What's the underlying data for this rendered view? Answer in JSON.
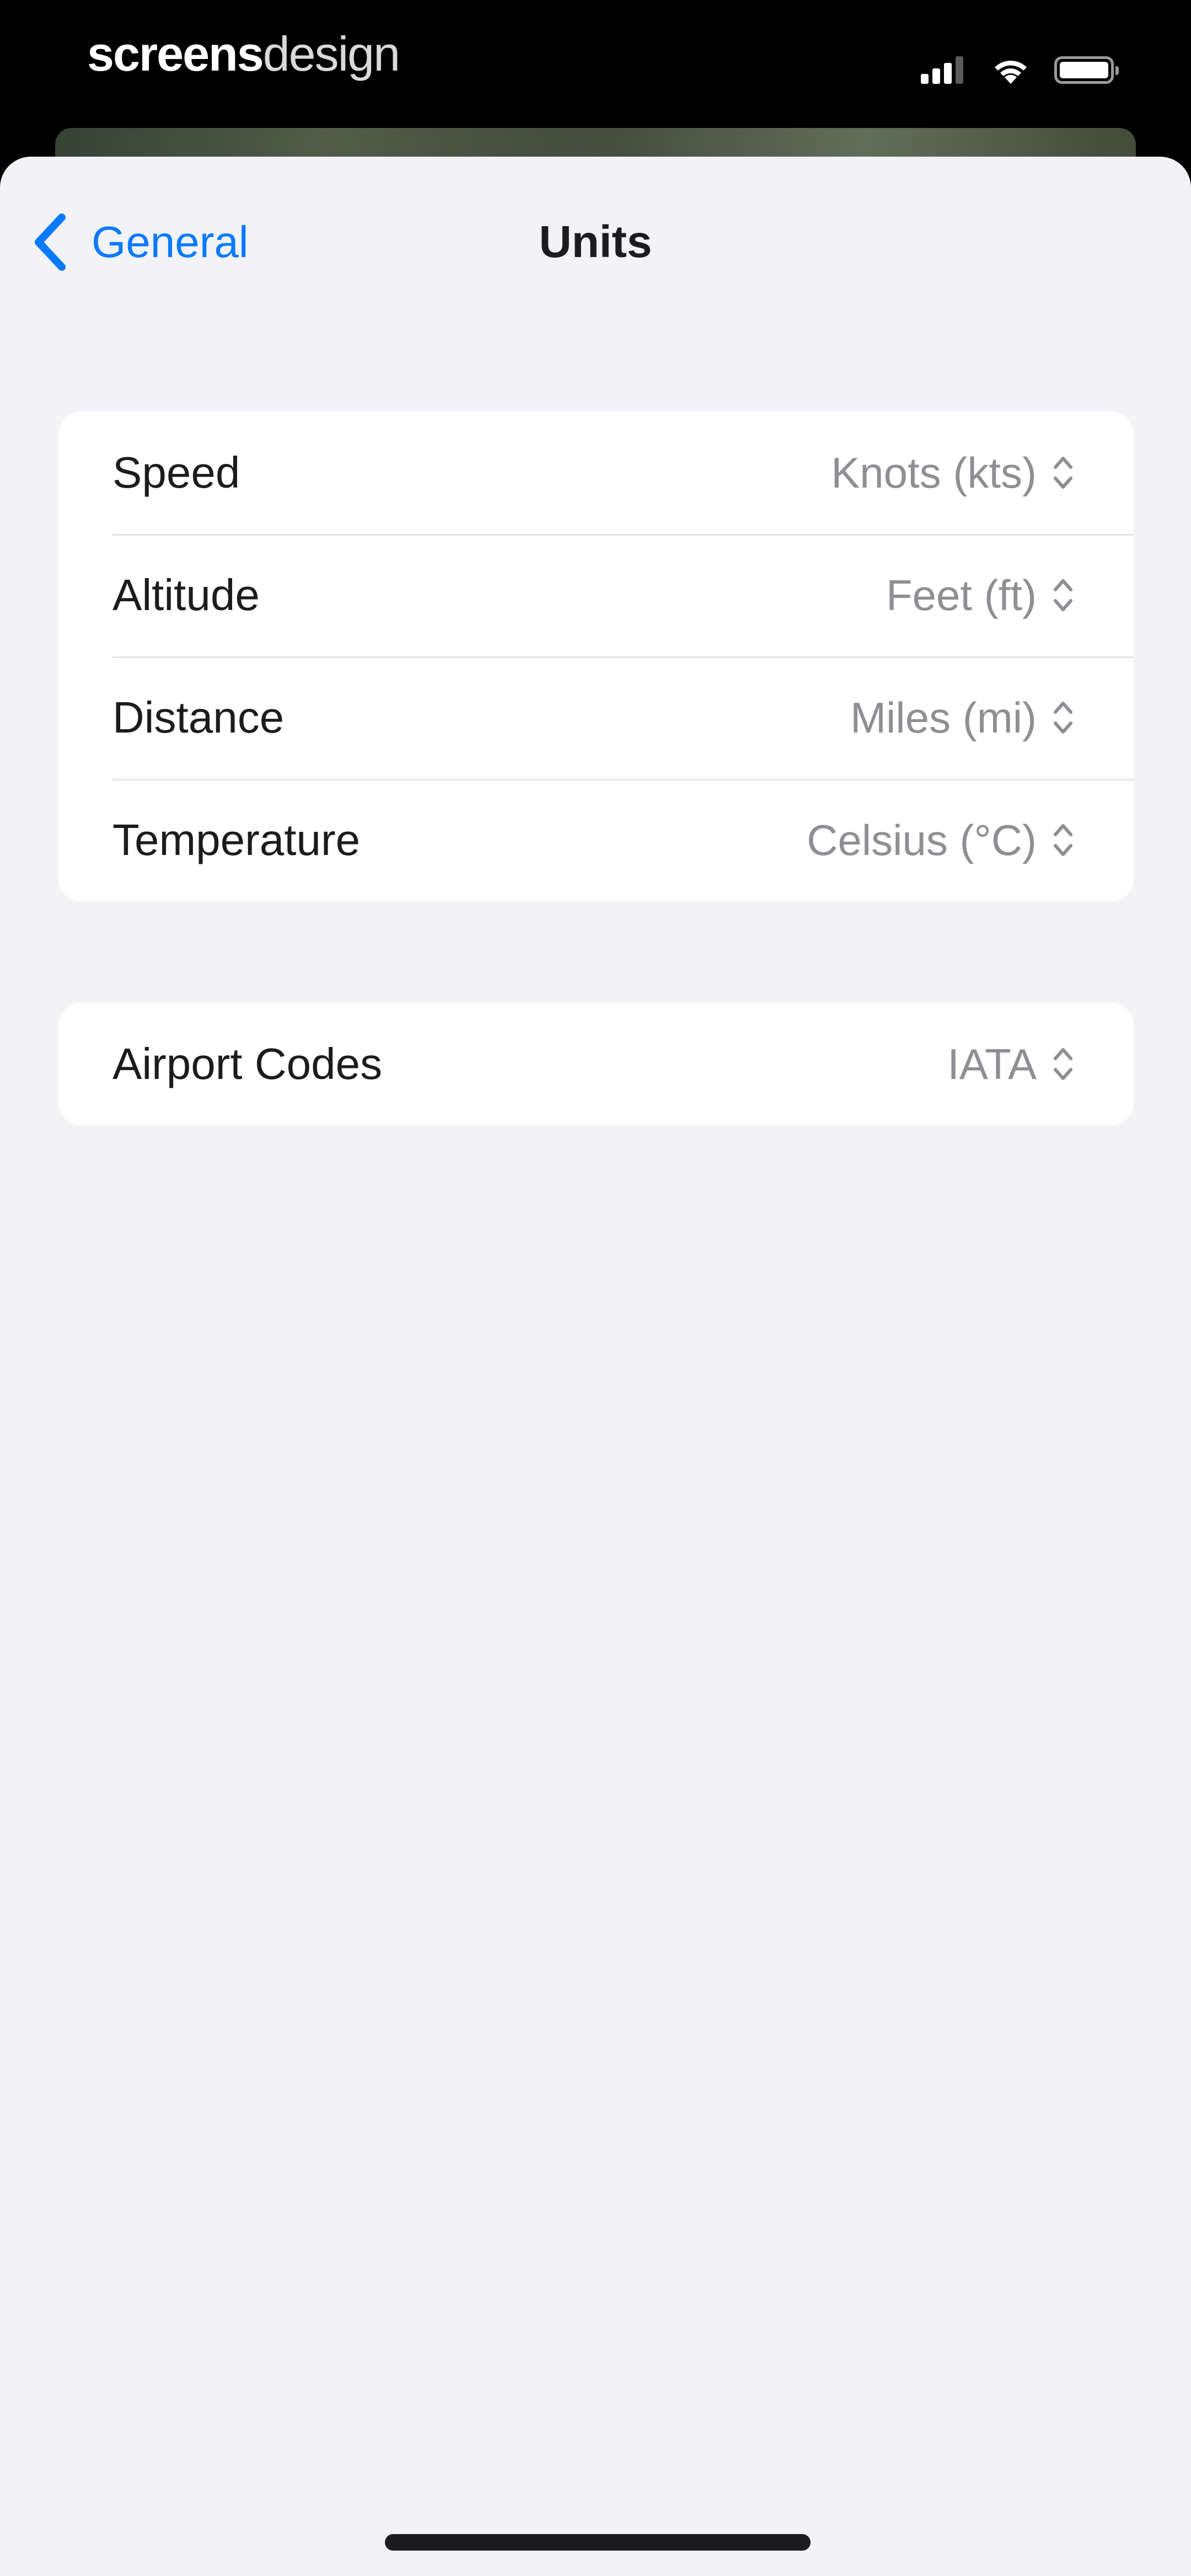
{
  "status_bar": {
    "brand_bold": "screens",
    "brand_light": "design"
  },
  "nav": {
    "back_label": "General",
    "title": "Units"
  },
  "units_group": {
    "rows": [
      {
        "label": "Speed",
        "value": "Knots (kts)"
      },
      {
        "label": "Altitude",
        "value": "Feet (ft)"
      },
      {
        "label": "Distance",
        "value": "Miles (mi)"
      },
      {
        "label": "Temperature",
        "value": "Celsius (°C)"
      }
    ]
  },
  "codes_group": {
    "rows": [
      {
        "label": "Airport Codes",
        "value": "IATA"
      }
    ]
  },
  "colors": {
    "accent": "#0a7aff",
    "background": "#f2f2f7",
    "card": "#ffffff",
    "label": "#1c1c1e",
    "secondary": "#8e8e93"
  },
  "icons": {
    "back": "chevron-left-icon",
    "picker": "chevron-up-down-icon",
    "signal": "cellular-signal-icon",
    "wifi": "wifi-icon",
    "battery": "battery-icon"
  }
}
